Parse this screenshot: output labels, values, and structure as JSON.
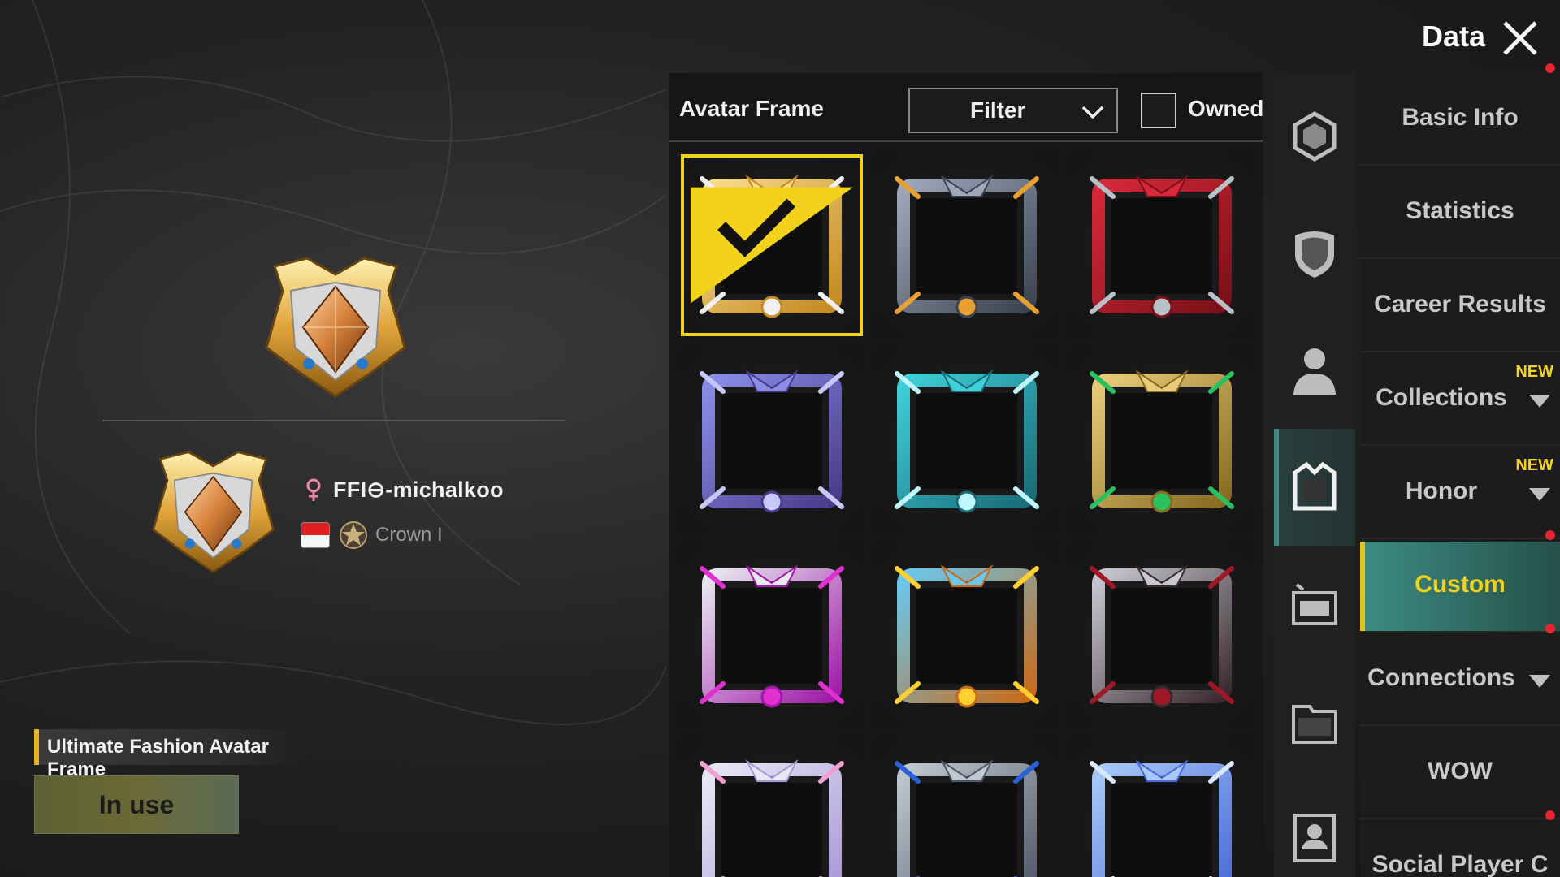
{
  "header": {
    "title": "Data",
    "close_icon": "close-icon"
  },
  "preview": {
    "player_name": "FFI⊖-michalkoo",
    "rank": "Crown I",
    "frame_name": "Ultimate Fashion Avatar Frame",
    "status_button": "In use",
    "flag_colors": [
      "#e02020",
      "#f5f5f5"
    ]
  },
  "panel": {
    "title": "Avatar Frame",
    "filter_label": "Filter",
    "owned_label": "Owned",
    "owned_checked": false
  },
  "frames": [
    {
      "style": "gold-wings",
      "selected": true
    },
    {
      "style": "steel-tech",
      "selected": false
    },
    {
      "style": "red-tentacle",
      "selected": false
    },
    {
      "style": "purple-crystal",
      "selected": false
    },
    {
      "style": "cyan-ice",
      "selected": false
    },
    {
      "style": "gold-ribbon",
      "selected": false
    },
    {
      "style": "magenta-bird",
      "selected": false
    },
    {
      "style": "phoenix-fire",
      "selected": false
    },
    {
      "style": "dark-rose",
      "selected": false
    },
    {
      "style": "silver-pink",
      "selected": false
    },
    {
      "style": "steel-blue-skull",
      "selected": false
    },
    {
      "style": "blue-rose",
      "selected": false
    }
  ],
  "rail_icons": [
    {
      "icon": "emblem-icon",
      "active": false
    },
    {
      "icon": "shield-icon",
      "active": false
    },
    {
      "icon": "avatar-icon",
      "active": false
    },
    {
      "icon": "avatar-frame-icon",
      "active": true
    },
    {
      "icon": "name-card-icon",
      "active": false
    },
    {
      "icon": "banner-icon",
      "active": false
    },
    {
      "icon": "id-card-icon",
      "active": false
    }
  ],
  "nav": {
    "items": [
      {
        "label": "Basic Info",
        "active": false,
        "arrow": false,
        "new": "",
        "dot": true
      },
      {
        "label": "Statistics",
        "active": false,
        "arrow": false,
        "new": "",
        "dot": false
      },
      {
        "label": "Career Results",
        "active": false,
        "arrow": false,
        "new": "",
        "dot": false
      },
      {
        "label": "Collections",
        "active": false,
        "arrow": true,
        "new": "NEW",
        "dot": false
      },
      {
        "label": "Honor",
        "active": false,
        "arrow": true,
        "new": "NEW",
        "dot": false
      },
      {
        "label": "Custom",
        "active": true,
        "arrow": false,
        "new": "",
        "dot": true
      },
      {
        "label": "Connections",
        "active": false,
        "arrow": true,
        "new": "",
        "dot": true
      },
      {
        "label": "WOW",
        "active": false,
        "arrow": false,
        "new": "",
        "dot": false
      },
      {
        "label": "Social Player C",
        "active": false,
        "arrow": false,
        "new": "",
        "dot": true
      }
    ]
  },
  "colors": {
    "accent_yellow": "#f4d21a",
    "active_teal": "#3c8b83",
    "notification_red": "#e8222f"
  }
}
